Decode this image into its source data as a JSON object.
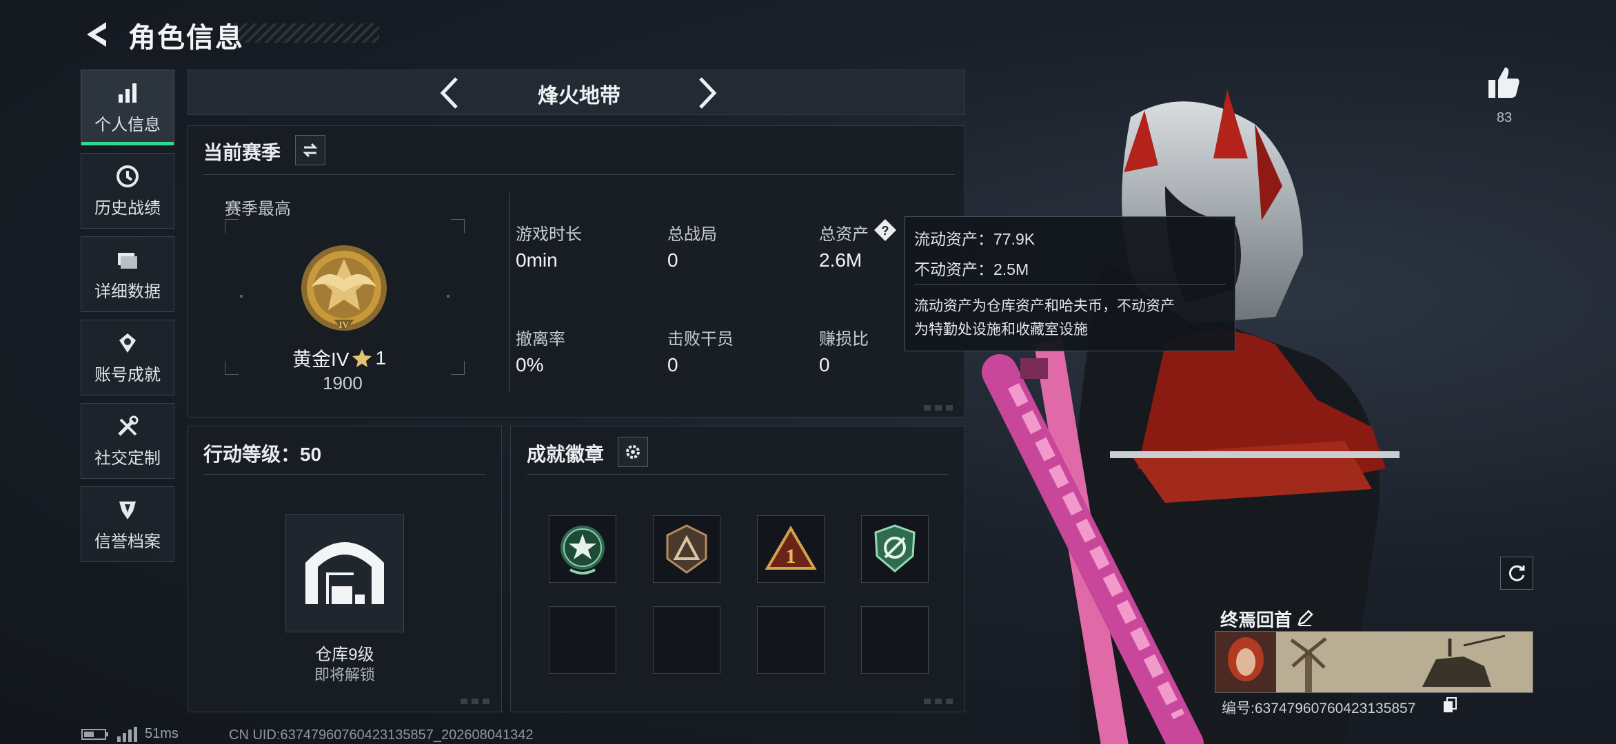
{
  "header": {
    "title": "角色信息"
  },
  "sidebar": {
    "items": [
      {
        "label": "个人信息",
        "icon": "bar-chart-icon",
        "active": true
      },
      {
        "label": "历史战绩",
        "icon": "clock-icon",
        "active": false
      },
      {
        "label": "详细数据",
        "icon": "folder-icon",
        "active": false
      },
      {
        "label": "账号成就",
        "icon": "medal-icon",
        "active": false
      },
      {
        "label": "社交定制",
        "icon": "tools-icon",
        "active": false
      },
      {
        "label": "信誉档案",
        "icon": "shield-icon",
        "active": false
      }
    ]
  },
  "mode": {
    "title": "烽火地带"
  },
  "season": {
    "heading": "当前赛季",
    "best_label": "赛季最高",
    "rank_name": "黄金IV",
    "rank_stars": "1",
    "rank_points": "1900",
    "stats": [
      {
        "label": "游戏时长",
        "value": "0min"
      },
      {
        "label": "总战局",
        "value": "0"
      },
      {
        "label": "总资产",
        "value": "2.6M"
      },
      {
        "label": "撤离率",
        "value": "0%"
      },
      {
        "label": "击败干员",
        "value": "0"
      },
      {
        "label": "赚损比",
        "value": "0"
      }
    ]
  },
  "tooltip": {
    "liquid": "流动资产：77.9K",
    "fixed": "不动资产：2.5M",
    "desc1": "流动资产为仓库资产和哈夫币，不动资产",
    "desc2": "为特勤处设施和收藏室设施"
  },
  "level": {
    "heading": "行动等级：50",
    "warehouse_label": "仓库9级",
    "warehouse_status": "即将解锁"
  },
  "badges": {
    "heading": "成就徽章",
    "items": [
      "star-badge-icon",
      "triangle-badge-icon",
      "number-one-badge-icon",
      "compass-badge-icon"
    ]
  },
  "right": {
    "like_count": "83",
    "card_title": "终焉回首",
    "card_id": "编号:6374796076042313585​7"
  },
  "footer": {
    "latency": "51ms",
    "uid": "CN UID:6374796076042313585​7_202608041342"
  },
  "colors": {
    "accent": "#31d896",
    "panel": "#181d24",
    "gold": "#c99a3c"
  }
}
